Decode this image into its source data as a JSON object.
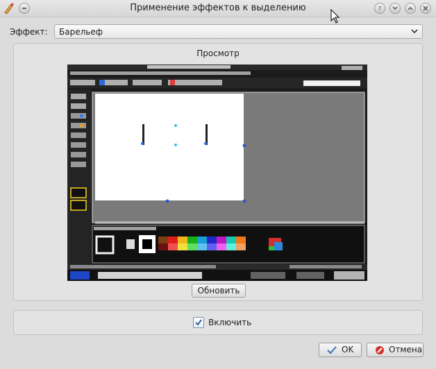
{
  "window": {
    "title": "Применение эффектов к выделению"
  },
  "effect": {
    "label": "Эффект:",
    "selected": "Барельеф"
  },
  "preview": {
    "title": "Просмотр",
    "update_label": "Обновить"
  },
  "enable": {
    "label": "Включить",
    "checked": true
  },
  "buttons": {
    "ok_label": "OK",
    "cancel_label": "Отмена"
  },
  "colors": {
    "accent": "#3d7bd1",
    "cancel": "#d0342c",
    "ok": "#3a6fb5"
  }
}
